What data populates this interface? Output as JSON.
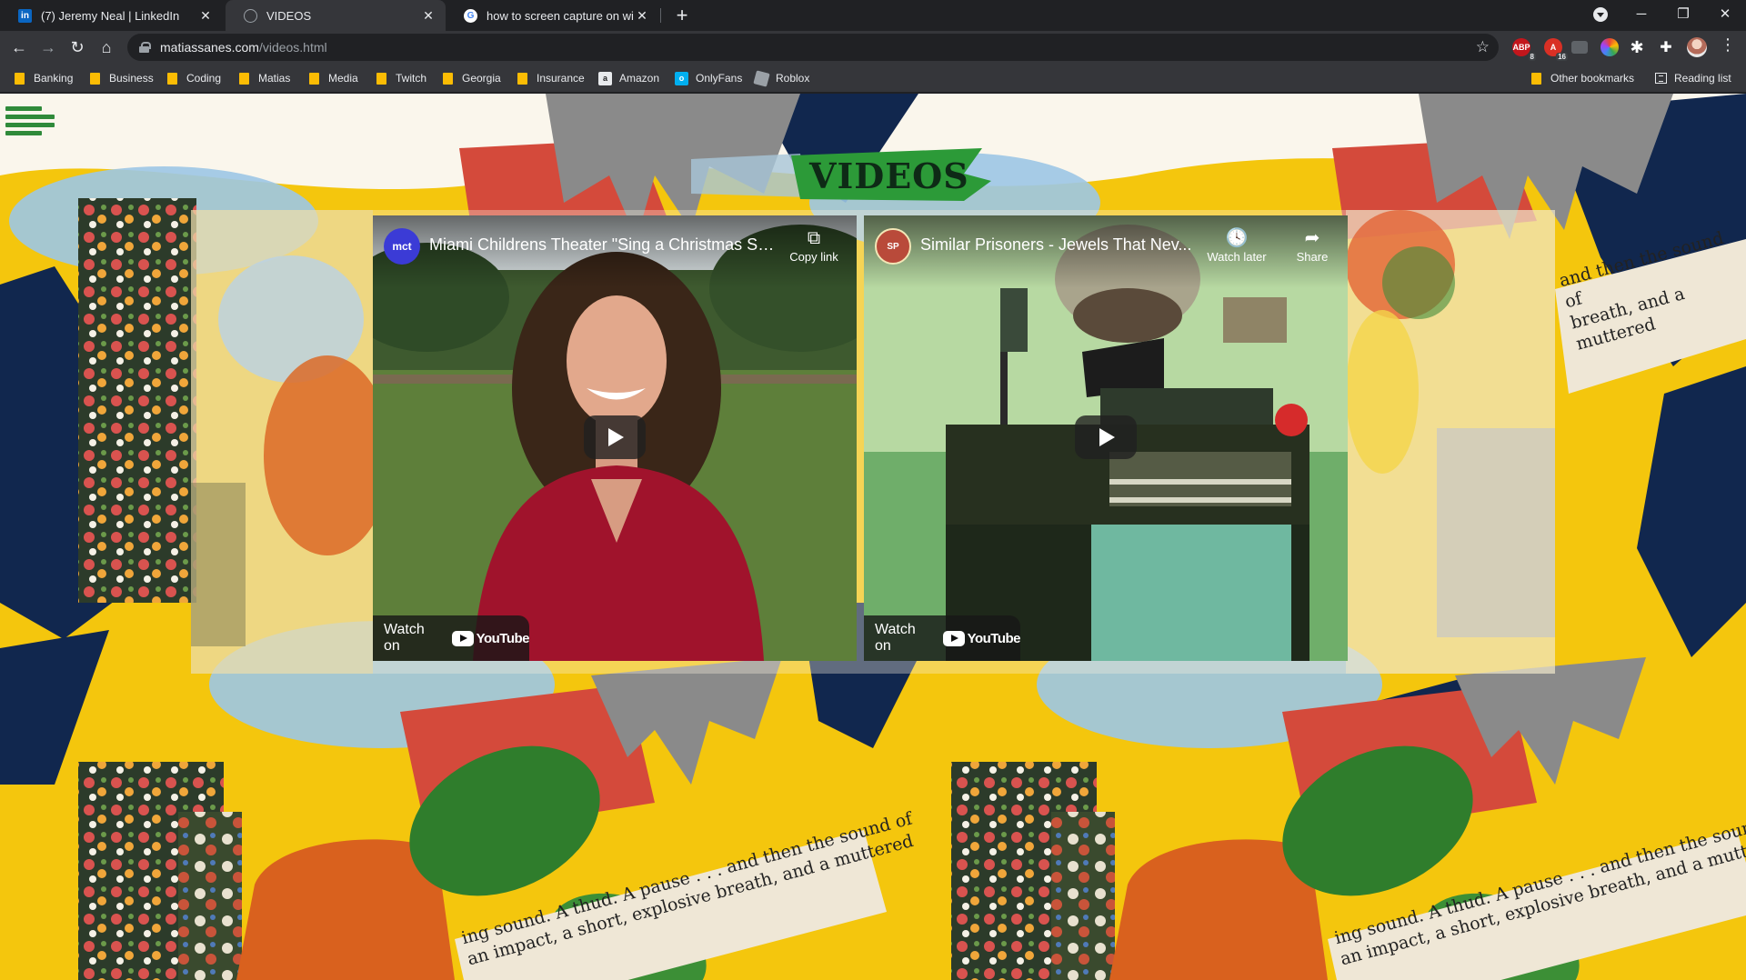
{
  "browser": {
    "tabs": [
      {
        "title": "(7) Jeremy Neal | LinkedIn",
        "favicon": "linkedin-icon",
        "favicon_text": "in",
        "color": "#0a66c2"
      },
      {
        "title": "VIDEOS",
        "favicon": "globe-icon",
        "color": "#9aa0a6"
      },
      {
        "title": "how to screen capture on windo",
        "favicon": "google-icon",
        "color": "#4285f4"
      }
    ],
    "active_tab": 1,
    "url_domain": "matiassanes.com",
    "url_path": "/videos.html",
    "extensions": [
      {
        "name": "abp-extension",
        "label": "ABP",
        "badge": "8",
        "color": "#c3161c"
      },
      {
        "name": "extension-2",
        "label": "A",
        "badge": "16",
        "color": "#d93025"
      },
      {
        "name": "extension-3",
        "label": "",
        "badge": "",
        "color": "#5f6368"
      },
      {
        "name": "color-extension",
        "label": "",
        "badge": "",
        "color": "#34a853"
      },
      {
        "name": "extension-5",
        "label": "✱",
        "badge": "",
        "color": "#35363a"
      },
      {
        "name": "puzzle-extension",
        "label": "",
        "badge": "",
        "color": "#35363a"
      }
    ],
    "bookmarks": [
      {
        "label": "Banking",
        "type": "folder"
      },
      {
        "label": "Business",
        "type": "folder"
      },
      {
        "label": "Coding",
        "type": "folder"
      },
      {
        "label": "Matias",
        "type": "folder"
      },
      {
        "label": "Media",
        "type": "folder"
      },
      {
        "label": "Twitch",
        "type": "folder"
      },
      {
        "label": "Georgia",
        "type": "folder"
      },
      {
        "label": "Insurance",
        "type": "folder"
      },
      {
        "label": "Amazon",
        "type": "site",
        "icon": "amazon-icon",
        "color": "#e8eaed"
      },
      {
        "label": "OnlyFans",
        "type": "site",
        "icon": "onlyfans-icon",
        "color": "#00aff0"
      },
      {
        "label": "Roblox",
        "type": "site",
        "icon": "roblox-icon",
        "color": "#9aa0a6"
      }
    ],
    "other_bookmarks": "Other bookmarks",
    "reading_list": "Reading list"
  },
  "page": {
    "heading": "VIDEOS",
    "collage_text_lines": [
      "and then the sound of",
      "breath, and a muttered"
    ],
    "collage_text_lower": [
      "ing sound. A thud. A pause . . . and then the sound of",
      "an impact, a short, explosive breath, and a muttered"
    ],
    "videos": [
      {
        "title": "Miami Childrens Theater \"Sing a Christmas So...",
        "channel_logo_text": "mct",
        "logo_color": "#3b3bd6",
        "actions": [
          {
            "icon": "copy-link-icon",
            "glyph": "⧉",
            "label": "Copy link"
          }
        ],
        "watch_on": "Watch on",
        "brand": "YouTube"
      },
      {
        "title": "Similar Prisoners - Jewels That Nev...",
        "channel_logo_text": "SP",
        "logo_color": "#b94a3a",
        "actions": [
          {
            "icon": "clock-icon",
            "glyph": "🕓",
            "label": "Watch later"
          },
          {
            "icon": "share-icon",
            "glyph": "➦",
            "label": "Share"
          }
        ],
        "watch_on": "Watch on",
        "brand": "YouTube"
      }
    ]
  }
}
